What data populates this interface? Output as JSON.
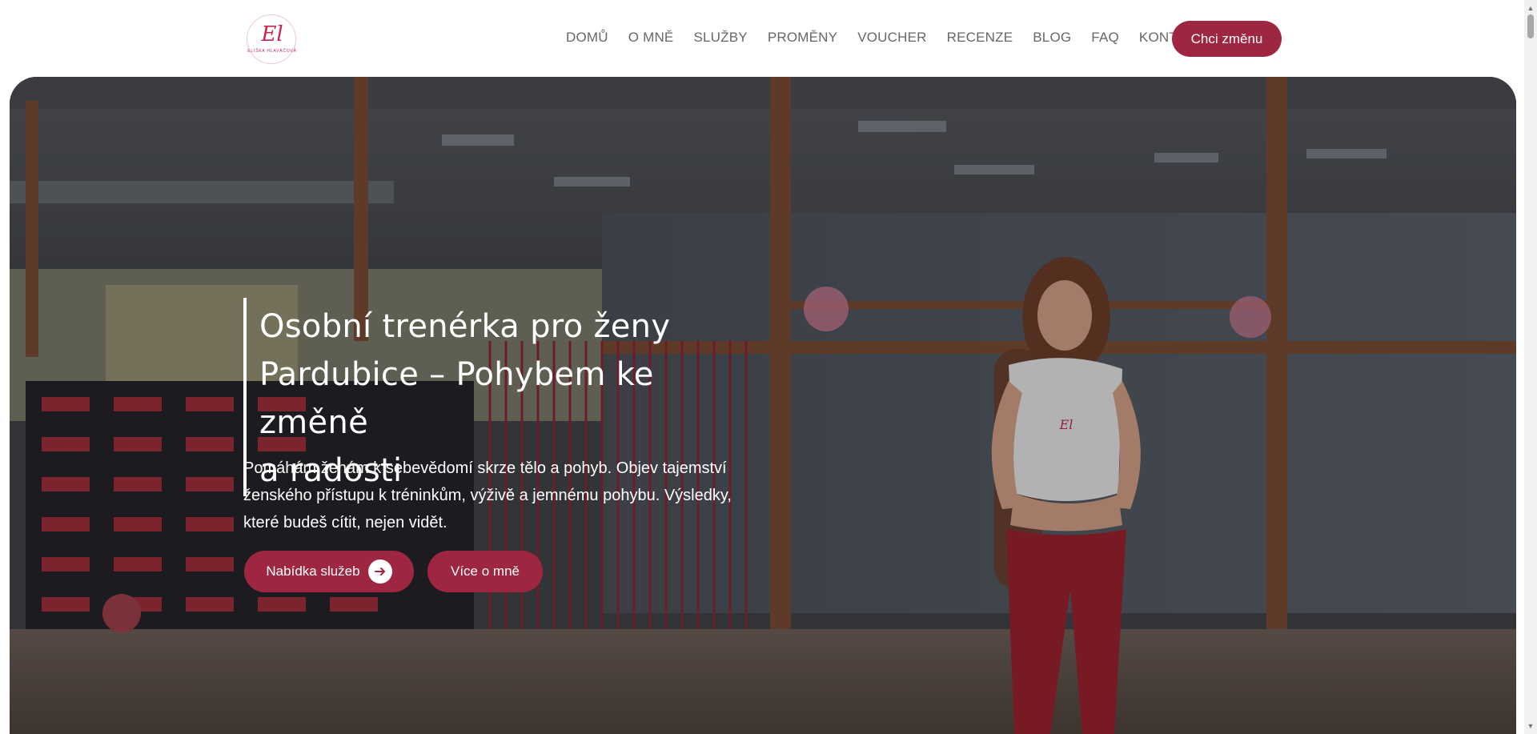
{
  "logo": {
    "monogram": "El",
    "name": "ELIŠKA HLAVÁČOVÁ"
  },
  "nav": {
    "items": [
      {
        "label": "DOMŮ"
      },
      {
        "label": "O MNĚ"
      },
      {
        "label": "SLUŽBY"
      },
      {
        "label": "PROMĚNY"
      },
      {
        "label": "VOUCHER"
      },
      {
        "label": "RECENZE"
      },
      {
        "label": "BLOG"
      },
      {
        "label": "FAQ"
      },
      {
        "label": "KONTAKT"
      }
    ],
    "cta_label": "Chci změnu"
  },
  "hero": {
    "headline_line1": "Osobní trenérka pro ženy",
    "headline_line2": "Pardubice – Pohybem ke změně",
    "headline_line3": "a radosti",
    "subtext_line1": "Pomáhám ženám k sebevědomí skrze tělo a pohyb. Objev tajemství",
    "subtext_line2": "ženského přístupu k tréninkům, výživě a jemnému pohybu. Výsledky,",
    "subtext_line3": "které budeš cítit, nejen vidět.",
    "primary_button": "Nabídka služeb",
    "secondary_button": "Více o mně"
  },
  "colors": {
    "accent": "#9f2640",
    "nav_text": "#666666",
    "hero_text": "#ffffff"
  }
}
